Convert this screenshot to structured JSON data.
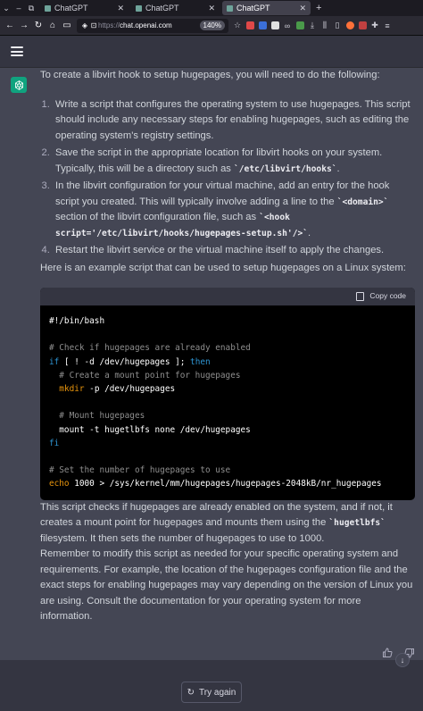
{
  "browser": {
    "tabs": [
      {
        "title": "ChatGPT",
        "active": false
      },
      {
        "title": "ChatGPT",
        "active": false
      },
      {
        "title": "ChatGPT",
        "active": true
      }
    ],
    "url_prefix": "https://",
    "url_host": "chat.openai.com",
    "zoom": "140%"
  },
  "message": {
    "intro": "To create a libvirt hook to setup hugepages, you will need to do the following:",
    "steps": [
      {
        "parts": [
          {
            "t": "Write a script that configures the operating system to use hugepages. This script should include any necessary steps for enabling hugepages, such as editing the operating system's registry settings."
          }
        ]
      },
      {
        "parts": [
          {
            "t": "Save the script in the appropriate location for libvirt hooks on your system. Typically, this will be a directory such as "
          },
          {
            "c": "`/etc/libvirt/hooks`"
          },
          {
            "t": "."
          }
        ]
      },
      {
        "parts": [
          {
            "t": "In the libvirt configuration for your virtual machine, add an entry for the hook script you created. This will typically involve adding a line to the "
          },
          {
            "c": "`<domain>`"
          },
          {
            "t": " section of the libvirt configuration file, such as "
          },
          {
            "c": "`<hook script='/etc/libvirt/hooks/hugepages-setup.sh'/>`"
          },
          {
            "t": "."
          }
        ]
      },
      {
        "parts": [
          {
            "t": "Restart the libvirt service or the virtual machine itself to apply the changes."
          }
        ]
      }
    ],
    "example_intro": "Here is an example script that can be used to setup hugepages on a Linux system:",
    "copy_label": "Copy code",
    "code_lines": [
      [
        {
          "s": "#!/bin/bash",
          "k": "plain"
        }
      ],
      [
        {
          "s": "",
          "k": "plain"
        }
      ],
      [
        {
          "s": "# Check if hugepages are already enabled",
          "k": "com"
        }
      ],
      [
        {
          "s": "if",
          "k": "kw"
        },
        {
          "s": " [ ! -d /dev/hugepages ]; ",
          "k": "plain"
        },
        {
          "s": "then",
          "k": "kw"
        }
      ],
      [
        {
          "s": "  # Create a mount point for hugepages",
          "k": "com"
        }
      ],
      [
        {
          "s": "  ",
          "k": "plain"
        },
        {
          "s": "mkdir",
          "k": "bi"
        },
        {
          "s": " -p /dev/hugepages",
          "k": "plain"
        }
      ],
      [
        {
          "s": "",
          "k": "plain"
        }
      ],
      [
        {
          "s": "  # Mount hugepages",
          "k": "com"
        }
      ],
      [
        {
          "s": "  mount -t hugetlbfs none /dev/hugepages",
          "k": "plain"
        }
      ],
      [
        {
          "s": "fi",
          "k": "kw"
        }
      ],
      [
        {
          "s": "",
          "k": "plain"
        }
      ],
      [
        {
          "s": "# Set the number of hugepages to use",
          "k": "com"
        }
      ],
      [
        {
          "s": "echo",
          "k": "bi"
        },
        {
          "s": " 1000 > /sys/kernel/mm/hugepages/hugepages-2048kB/nr_hugepages",
          "k": "plain"
        }
      ]
    ],
    "explanation": [
      {
        "t": "This script checks if hugepages are already enabled on the system, and if not, it creates a mount point for hugepages and mounts them using the "
      },
      {
        "c": "`hugetlbfs`"
      },
      {
        "t": " filesystem. It then sets the number of hugepages to use to 1000."
      }
    ],
    "reminder": "Remember to modify this script as needed for your specific operating system and requirements. For example, the location of the hugepages configuration file and the exact steps for enabling hugepages may vary depending on the version of Linux you are using. Consult the documentation for your operating system for more information."
  },
  "actions": {
    "try_again": "Try again"
  },
  "colors": {
    "page_bg": "#343541",
    "message_bg": "#444654",
    "accent": "#10a37f"
  }
}
